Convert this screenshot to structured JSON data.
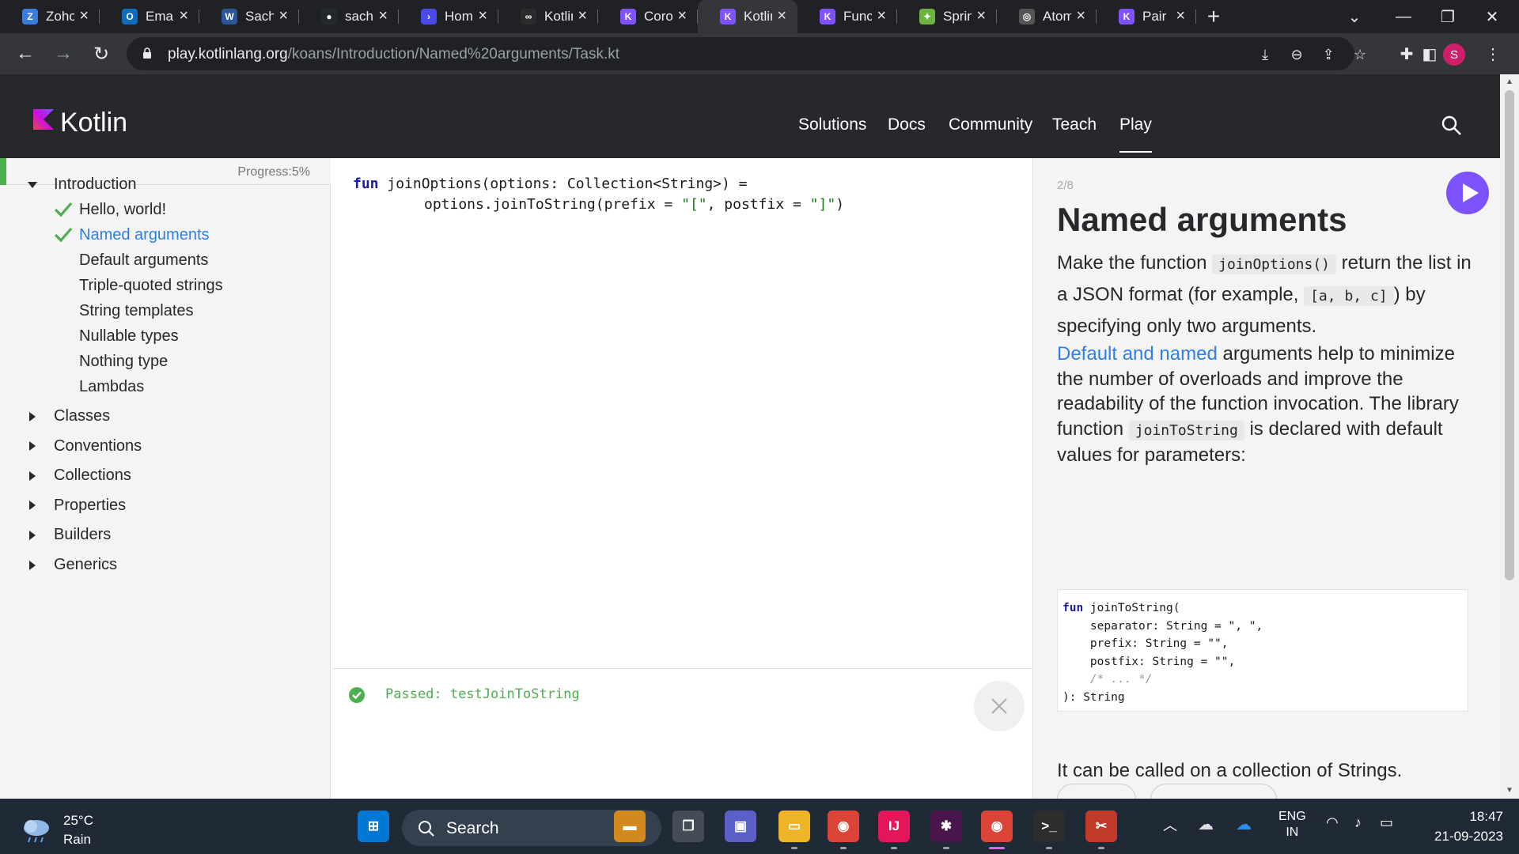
{
  "browser": {
    "tabs": [
      {
        "title": "Zoho",
        "favicon_color": "#3b7ddd",
        "favicon_glyph": "Z",
        "icon": "zoho-icon"
      },
      {
        "title": "Email",
        "favicon_color": "#0f6cbd",
        "favicon_glyph": "O",
        "icon": "outlook-icon"
      },
      {
        "title": "Sachin",
        "favicon_color": "#2b579a",
        "favicon_glyph": "W",
        "icon": "word-icon"
      },
      {
        "title": "sachin",
        "favicon_color": "#24292e",
        "favicon_glyph": "●",
        "icon": "github-icon"
      },
      {
        "title": "Home",
        "favicon_color": "#4a4ae6",
        "favicon_glyph": "›",
        "icon": "terminal-icon"
      },
      {
        "title": "Kotlin",
        "favicon_color": "#2b2b2b",
        "favicon_glyph": "∞",
        "icon": "link-icon"
      },
      {
        "title": "Coroutines",
        "favicon_color": "#7f52ff",
        "favicon_glyph": "K",
        "icon": "kotlin-icon"
      },
      {
        "title": "Kotlin Koans",
        "favicon_color": "#7f52ff",
        "favicon_glyph": "K",
        "icon": "kotlin-icon",
        "active": true
      },
      {
        "title": "Functions",
        "favicon_color": "#7f52ff",
        "favicon_glyph": "K",
        "icon": "kotlin-icon"
      },
      {
        "title": "Spring",
        "favicon_color": "#6db33f",
        "favicon_glyph": "✦",
        "icon": "spring-icon"
      },
      {
        "title": "Atom",
        "favicon_color": "#555555",
        "favicon_glyph": "◎",
        "icon": "globe-icon"
      },
      {
        "title": "Pair",
        "favicon_color": "#7f52ff",
        "favicon_glyph": "K",
        "icon": "kotlin-icon"
      }
    ],
    "url_host": "play.kotlinlang.org",
    "url_path": "/koans/Introduction/Named%20arguments/Task.kt",
    "profile_initial": "S"
  },
  "kotlin": {
    "logo_text": "Kotlin",
    "nav": [
      "Solutions",
      "Docs",
      "Community",
      "Teach",
      "Play"
    ],
    "active_nav": "Play"
  },
  "sidebar": {
    "progress_label": "Progress:5%",
    "progress_fraction": 0.05,
    "open_section": "Introduction",
    "items": [
      {
        "label": "Hello, world!",
        "done": true
      },
      {
        "label": "Named arguments",
        "done": true,
        "current": true
      },
      {
        "label": "Default arguments"
      },
      {
        "label": "Triple-quoted strings"
      },
      {
        "label": "String templates"
      },
      {
        "label": "Nullable types"
      },
      {
        "label": "Nothing type"
      },
      {
        "label": "Lambdas"
      }
    ],
    "sections": [
      "Classes",
      "Conventions",
      "Collections",
      "Properties",
      "Builders",
      "Generics"
    ]
  },
  "editor": {
    "line1_kw": "fun",
    "line1_rest": " joinOptions(options: Collection<String>) =",
    "line2_a": "options.joinToString(prefix = ",
    "line2_s1": "\"[\"",
    "line2_b": ", postfix = ",
    "line2_s2": "\"]\"",
    "line2_c": ")"
  },
  "results": {
    "passed_text": "Passed: testJoinToString"
  },
  "task": {
    "counter": "2/8",
    "title": "Named arguments",
    "p1_a": "Make the function ",
    "p1_code1": "joinOptions()",
    "p1_b": " return the list in a JSON format (for example, ",
    "p1_code2": "[a, b, c]",
    "p1_c": ") by specifying only two arguments.",
    "p2_link": "Default and named",
    "p2_a": " arguments help to minimize the number of overloads and improve the readability of the function invocation. The library function ",
    "p2_code": "joinToString",
    "p2_b": " is declared with default values for parameters:",
    "code_kw": "fun",
    "code_l1": " joinToString(",
    "code_l2": "    separator: String = \", \",",
    "code_l3": "    prefix: String = \"\",",
    "code_l4": "    postfix: String = \"\",",
    "code_l5": "    /* ... */",
    "code_l6": "): String",
    "p3": "It can be called on a collection of Strings."
  },
  "taskbar": {
    "temperature": "25°C",
    "condition": "Rain",
    "search_label": "Search",
    "lang_top": "ENG",
    "lang_bottom": "IN",
    "time": "18:47",
    "date": "21-09-2023",
    "apps": [
      {
        "icon": "start-icon",
        "color": "#0078d4",
        "glyph": "⊞"
      },
      {
        "icon": "briefcase-icon",
        "color": "#d28a1e",
        "glyph": "▬"
      },
      {
        "icon": "taskview-icon",
        "color": "#444d57",
        "glyph": "❐"
      },
      {
        "icon": "teams-icon",
        "color": "#5b5fc7",
        "glyph": "▣"
      },
      {
        "icon": "file-explorer-icon",
        "color": "#f0b429",
        "glyph": "▭"
      },
      {
        "icon": "chrome-icon",
        "color": "#db4437",
        "glyph": "◉"
      },
      {
        "icon": "intellij-icon",
        "color": "#e3165b",
        "glyph": "IJ"
      },
      {
        "icon": "slack-icon",
        "color": "#4a154b",
        "glyph": "✱"
      },
      {
        "icon": "chrome-profile-icon",
        "color": "#db4437",
        "glyph": "◉"
      },
      {
        "icon": "terminal-app-icon",
        "color": "#2d2d2d",
        "glyph": ">_"
      },
      {
        "icon": "snipping-tool-icon",
        "color": "#c0392b",
        "glyph": "✂"
      }
    ]
  }
}
